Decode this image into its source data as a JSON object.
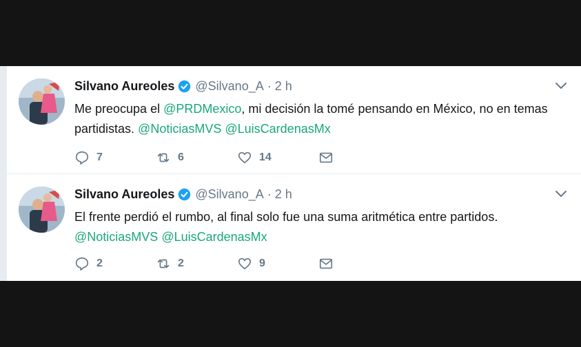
{
  "colors": {
    "mention": "#19a974",
    "muted": "#657786",
    "verified": "#1da1f2"
  },
  "tweets": [
    {
      "author": "Silvano Aureoles",
      "handle": "@Silvano_A",
      "separator": "·",
      "time": "2 h",
      "text_parts": [
        {
          "text": "Me preocupa el ",
          "mention": false
        },
        {
          "text": "@PRDMexico",
          "mention": true
        },
        {
          "text": ", mi decisión la tomé pensando en México, no en temas partidistas. ",
          "mention": false
        },
        {
          "text": "@NoticiasMVS",
          "mention": true
        },
        {
          "text": " ",
          "mention": false
        },
        {
          "text": "@LuisCardenasMx",
          "mention": true
        }
      ],
      "replies": "7",
      "retweets": "6",
      "likes": "14",
      "icons": [
        "reply-icon",
        "retweet-icon",
        "like-icon",
        "direct-message-icon",
        "verified-icon",
        "chevron-down-icon"
      ]
    },
    {
      "author": "Silvano Aureoles",
      "handle": "@Silvano_A",
      "separator": "·",
      "time": "2 h",
      "text_parts": [
        {
          "text": "El frente perdió el rumbo, al final solo fue una suma aritmética entre partidos. ",
          "mention": false
        },
        {
          "text": "@NoticiasMVS",
          "mention": true
        },
        {
          "text": " ",
          "mention": false
        },
        {
          "text": "@LuisCardenasMx",
          "mention": true
        }
      ],
      "replies": "2",
      "retweets": "2",
      "likes": "9",
      "icons": [
        "reply-icon",
        "retweet-icon",
        "like-icon",
        "direct-message-icon",
        "verified-icon",
        "chevron-down-icon"
      ]
    }
  ]
}
